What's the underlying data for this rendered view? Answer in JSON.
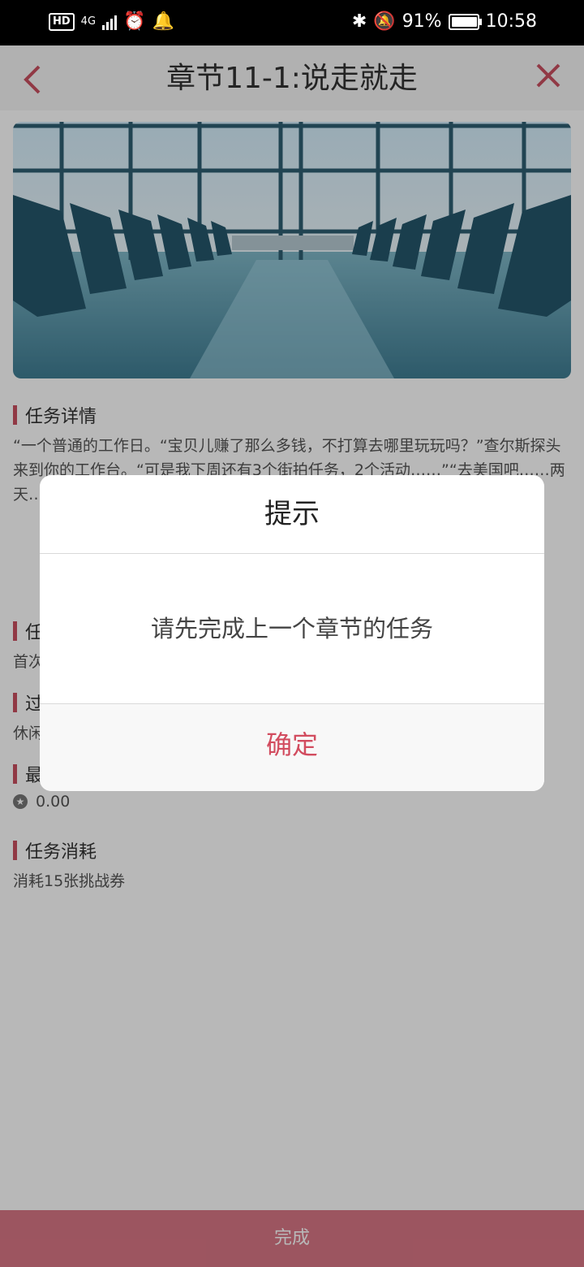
{
  "status_bar": {
    "hd": "HD",
    "network": "4G",
    "battery": "91%",
    "battery_level": 0.91,
    "time": "10:58"
  },
  "header": {
    "title": "章节11-1:说走就走",
    "back_icon": "chevron-left-icon",
    "close_icon": "close-icon"
  },
  "hero": {
    "icon": "airport-hall-image"
  },
  "sections": {
    "details": {
      "title": "任务详情",
      "text": "“一个普通的工作日。“宝贝儿赚了那么多钱，不打算去哪里玩玩吗？”查尔斯探头来到你的工作台。“可是我下周还有3个街拍任务，2个活动……”“去美国吧……两天……了。请先……"
    },
    "goal": {
      "title": "任",
      "text": "首次"
    },
    "pass": {
      "title": "过",
      "text": "休闲"
    },
    "best": {
      "title": "最",
      "score": "0.00"
    },
    "consume": {
      "title": "任务消耗",
      "text": "消耗15张挑战券"
    }
  },
  "footer": {
    "done_label": "完成"
  },
  "dialog": {
    "title": "提示",
    "message": "请先完成上一个章节的任务",
    "confirm_label": "确定"
  },
  "colors": {
    "accent": "#c94f60",
    "footer_bg": "#d97685"
  }
}
